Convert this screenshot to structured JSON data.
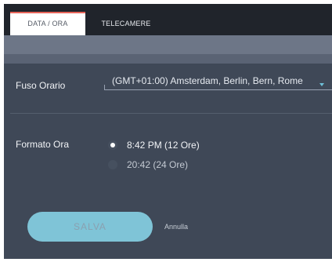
{
  "tabs": [
    {
      "label": "DATA / ORA",
      "active": true
    },
    {
      "label": "TELECAMERE",
      "active": false
    }
  ],
  "timezone": {
    "label": "Fuso Orario",
    "value": "(GMT+01:00) Amsterdam, Berlin, Bern, Rome"
  },
  "time_format": {
    "label": "Formato Ora",
    "options": [
      {
        "label": "8:42 PM (12 Ore)",
        "checked": true
      },
      {
        "label": "20:42 (24 Ore)",
        "checked": false
      }
    ]
  },
  "actions": {
    "save_label": "SALVA",
    "cancel_label": "Annulla"
  },
  "colors": {
    "accent": "#e7655a",
    "primary_button": "#7fc4d7",
    "panel_background": "#3f4857",
    "tab_bar": "#20242b"
  }
}
